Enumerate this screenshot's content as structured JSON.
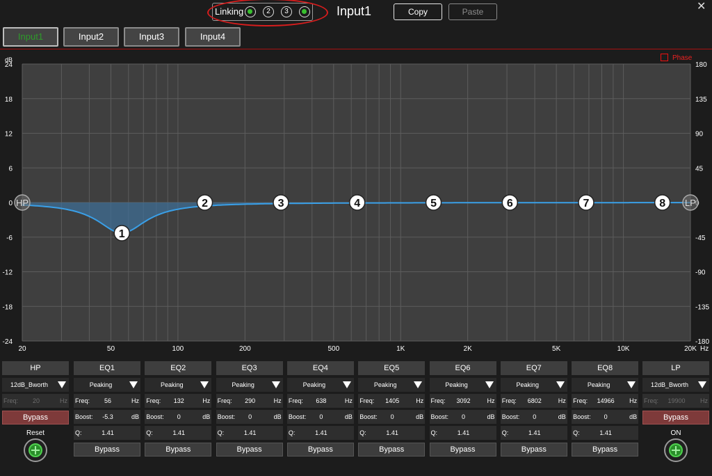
{
  "header": {
    "linking_label": "Linking",
    "link_channels": [
      {
        "label": "",
        "active": true
      },
      {
        "label": "2",
        "active": false
      },
      {
        "label": "3",
        "active": false
      },
      {
        "label": "",
        "active": true
      }
    ],
    "title": "Input1",
    "copy_label": "Copy",
    "paste_label": "Paste",
    "close_glyph": "✕"
  },
  "tabs": [
    {
      "label": "Input1",
      "active": true
    },
    {
      "label": "Input2",
      "active": false
    },
    {
      "label": "Input3",
      "active": false
    },
    {
      "label": "Input4",
      "active": false
    }
  ],
  "graph": {
    "db_unit": "dB",
    "db_ticks": [
      "24",
      "18",
      "12",
      "6",
      "0",
      "-6",
      "-12",
      "-18",
      "-24"
    ],
    "phase_ticks": [
      "180",
      "135",
      "90",
      "45",
      "0",
      "-45",
      "-90",
      "-135",
      "-180"
    ],
    "freq_ticks": [
      "20",
      "50",
      "100",
      "200",
      "500",
      "1K",
      "2K",
      "5K",
      "10K",
      "20K"
    ],
    "freq_unit": "Hz",
    "phase_label": "Phase",
    "phase_checked": false,
    "hp_marker": "HP",
    "lp_marker": "LP",
    "colors": {
      "curve": "#3aa0e8",
      "fill": "#3f6e94",
      "grid": "#5d5d5d",
      "plot_bg": "#3f3f3f"
    }
  },
  "hp": {
    "title": "HP",
    "type": "12dB_Bworth",
    "freq_label": "Freq:",
    "freq_value": "20",
    "freq_unit": "Hz",
    "bypass_label": "Bypass",
    "action_label": "Reset"
  },
  "lp": {
    "title": "LP",
    "type": "12dB_Bworth",
    "freq_label": "Freq:",
    "freq_value": "19900",
    "freq_unit": "Hz",
    "bypass_label": "Bypass",
    "action_label": "ON"
  },
  "eq_bands": [
    {
      "title": "EQ1",
      "marker": "1",
      "type": "Peaking",
      "freq": "56",
      "boost": "-5.3",
      "q": "1.41",
      "bypass": "Bypass"
    },
    {
      "title": "EQ2",
      "marker": "2",
      "type": "Peaking",
      "freq": "132",
      "boost": "0",
      "q": "1.41",
      "bypass": "Bypass"
    },
    {
      "title": "EQ3",
      "marker": "3",
      "type": "Peaking",
      "freq": "290",
      "boost": "0",
      "q": "1.41",
      "bypass": "Bypass"
    },
    {
      "title": "EQ4",
      "marker": "4",
      "type": "Peaking",
      "freq": "638",
      "boost": "0",
      "q": "1.41",
      "bypass": "Bypass"
    },
    {
      "title": "EQ5",
      "marker": "5",
      "type": "Peaking",
      "freq": "1405",
      "boost": "0",
      "q": "1.41",
      "bypass": "Bypass"
    },
    {
      "title": "EQ6",
      "marker": "6",
      "type": "Peaking",
      "freq": "3092",
      "boost": "0",
      "q": "1.41",
      "bypass": "Bypass"
    },
    {
      "title": "EQ7",
      "marker": "7",
      "type": "Peaking",
      "freq": "6802",
      "boost": "0",
      "q": "1.41",
      "bypass": "Bypass"
    },
    {
      "title": "EQ8",
      "marker": "8",
      "type": "Peaking",
      "freq": "14966",
      "boost": "0",
      "q": "1.41",
      "bypass": "Bypass"
    }
  ],
  "eq_labels": {
    "freq": "Freq:",
    "freq_unit": "Hz",
    "boost": "Boost:",
    "boost_unit": "dB",
    "q": "Q:"
  }
}
